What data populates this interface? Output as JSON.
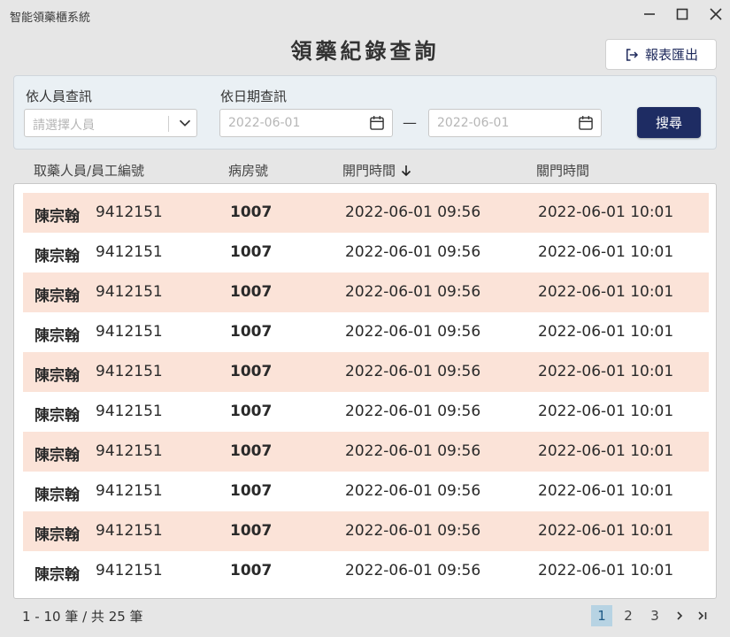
{
  "window": {
    "title": "智能領藥櫃系統"
  },
  "header": {
    "title": "領藥紀錄查詢",
    "export_label": "報表匯出"
  },
  "filters": {
    "person_label": "依人員查訊",
    "person_placeholder": "請選擇人員",
    "date_label": "依日期查訊",
    "date_from": "2022-06-01",
    "date_to": "2022-06-01",
    "dash": "—",
    "search_label": "搜尋"
  },
  "table": {
    "columns": [
      "取藥人員/員工編號",
      "病房號",
      "開門時間",
      "關門時間"
    ],
    "rows": [
      {
        "name": "陳宗翰",
        "employee_id": "9412151",
        "room": "1007",
        "open_time": "2022-06-01 09:56",
        "close_time": "2022-06-01 10:01"
      },
      {
        "name": "陳宗翰",
        "employee_id": "9412151",
        "room": "1007",
        "open_time": "2022-06-01 09:56",
        "close_time": "2022-06-01 10:01"
      },
      {
        "name": "陳宗翰",
        "employee_id": "9412151",
        "room": "1007",
        "open_time": "2022-06-01 09:56",
        "close_time": "2022-06-01 10:01"
      },
      {
        "name": "陳宗翰",
        "employee_id": "9412151",
        "room": "1007",
        "open_time": "2022-06-01 09:56",
        "close_time": "2022-06-01 10:01"
      },
      {
        "name": "陳宗翰",
        "employee_id": "9412151",
        "room": "1007",
        "open_time": "2022-06-01 09:56",
        "close_time": "2022-06-01 10:01"
      },
      {
        "name": "陳宗翰",
        "employee_id": "9412151",
        "room": "1007",
        "open_time": "2022-06-01 09:56",
        "close_time": "2022-06-01 10:01"
      },
      {
        "name": "陳宗翰",
        "employee_id": "9412151",
        "room": "1007",
        "open_time": "2022-06-01 09:56",
        "close_time": "2022-06-01 10:01"
      },
      {
        "name": "陳宗翰",
        "employee_id": "9412151",
        "room": "1007",
        "open_time": "2022-06-01 09:56",
        "close_time": "2022-06-01 10:01"
      },
      {
        "name": "陳宗翰",
        "employee_id": "9412151",
        "room": "1007",
        "open_time": "2022-06-01 09:56",
        "close_time": "2022-06-01 10:01"
      },
      {
        "name": "陳宗翰",
        "employee_id": "9412151",
        "room": "1007",
        "open_time": "2022-06-01 09:56",
        "close_time": "2022-06-01 10:01"
      }
    ]
  },
  "pagination": {
    "summary": "1 - 10 筆 / 共 25 筆",
    "pages": [
      "1",
      "2",
      "3"
    ],
    "current": "1"
  },
  "colors": {
    "accent": "#1e2c63",
    "row_highlight": "#fbe3d8",
    "current_page": "#b7d3e3"
  },
  "icons": {
    "export": "logout-arrow-icon",
    "dropdown": "chevron-down-icon",
    "calendar": "calendar-icon",
    "sort": "arrow-down-icon",
    "next": "chevron-right-icon",
    "last": "last-page-icon"
  }
}
